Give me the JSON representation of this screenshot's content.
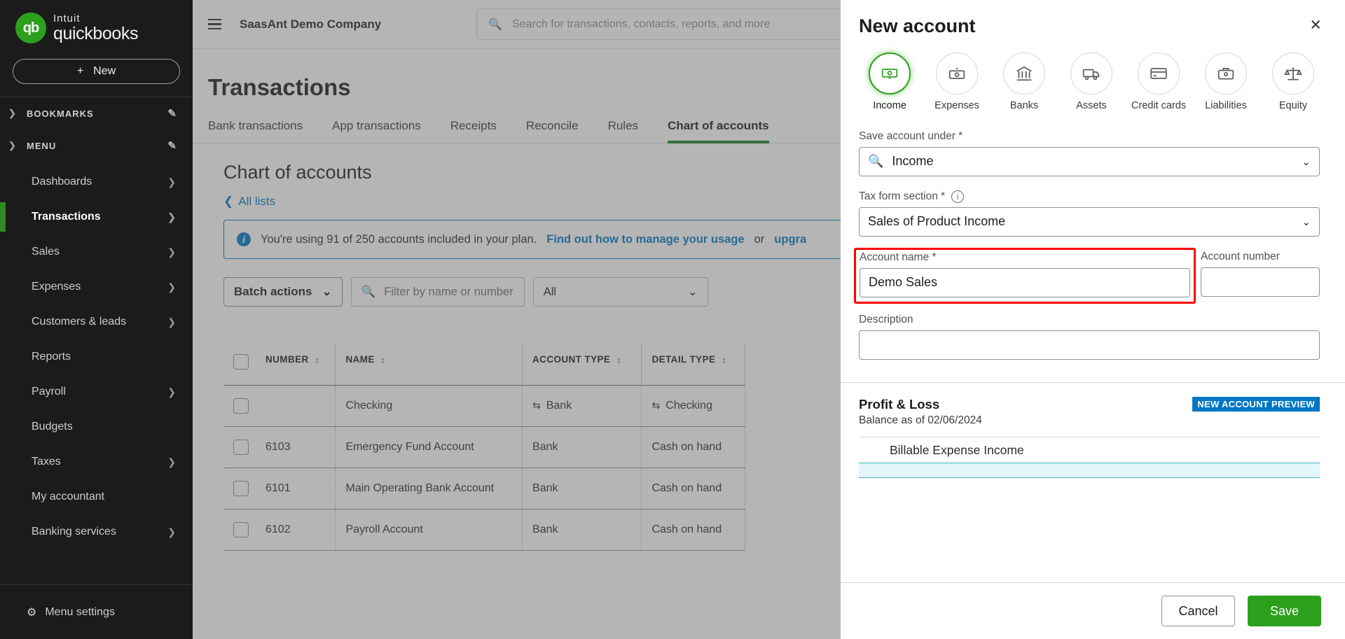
{
  "sidebar": {
    "brand": {
      "intuit": "Intuit",
      "product": "quickbooks"
    },
    "new_button": "New",
    "bookmarks_label": "BOOKMARKS",
    "menu_label": "MENU",
    "items": [
      {
        "label": "Dashboards",
        "has_arrow": true,
        "active": false
      },
      {
        "label": "Transactions",
        "has_arrow": true,
        "active": true
      },
      {
        "label": "Sales",
        "has_arrow": true,
        "active": false
      },
      {
        "label": "Expenses",
        "has_arrow": true,
        "active": false
      },
      {
        "label": "Customers & leads",
        "has_arrow": true,
        "active": false
      },
      {
        "label": "Reports",
        "has_arrow": false,
        "active": false
      },
      {
        "label": "Payroll",
        "has_arrow": true,
        "active": false
      },
      {
        "label": "Budgets",
        "has_arrow": false,
        "active": false
      },
      {
        "label": "Taxes",
        "has_arrow": true,
        "active": false
      },
      {
        "label": "My accountant",
        "has_arrow": false,
        "active": false
      },
      {
        "label": "Banking services",
        "has_arrow": true,
        "active": false
      }
    ],
    "menu_settings": "Menu settings"
  },
  "topbar": {
    "company": "SaasAnt Demo Company",
    "search_placeholder": "Search for transactions, contacts, reports, and more"
  },
  "page": {
    "title": "Transactions",
    "tabs": [
      {
        "label": "Bank transactions",
        "active": false
      },
      {
        "label": "App transactions",
        "active": false
      },
      {
        "label": "Receipts",
        "active": false
      },
      {
        "label": "Reconcile",
        "active": false
      },
      {
        "label": "Rules",
        "active": false
      },
      {
        "label": "Chart of accounts",
        "active": true
      }
    ],
    "section_title": "Chart of accounts",
    "back_link": "All lists",
    "banner": {
      "text_before": "You're using 91 of 250 accounts included in your plan.",
      "link1": "Find out how to manage your usage",
      "text_middle": "or",
      "link2": "upgra"
    },
    "filters": {
      "batch_actions": "Batch actions",
      "filter_placeholder": "Filter by name or number",
      "select_value": "All"
    },
    "table": {
      "columns": [
        "NUMBER",
        "NAME",
        "ACCOUNT TYPE",
        "DETAIL TYPE"
      ],
      "rows": [
        {
          "number": "",
          "name": "Checking",
          "account_type": "Bank",
          "detail_type": "Checking",
          "icon": true
        },
        {
          "number": "6103",
          "name": "Emergency Fund Account",
          "account_type": "Bank",
          "detail_type": "Cash on hand",
          "icon": false
        },
        {
          "number": "6101",
          "name": "Main Operating Bank Account",
          "account_type": "Bank",
          "detail_type": "Cash on hand",
          "icon": false
        },
        {
          "number": "6102",
          "name": "Payroll Account",
          "account_type": "Bank",
          "detail_type": "Cash on hand",
          "icon": false
        }
      ]
    }
  },
  "panel": {
    "title": "New account",
    "close_label": "×",
    "account_types": [
      {
        "label": "Income",
        "icon": "income-bill-icon",
        "selected": true
      },
      {
        "label": "Expenses",
        "icon": "expenses-bill-icon",
        "selected": false
      },
      {
        "label": "Banks",
        "icon": "bank-building-icon",
        "selected": false
      },
      {
        "label": "Assets",
        "icon": "truck-icon",
        "selected": false
      },
      {
        "label": "Credit cards",
        "icon": "credit-card-icon",
        "selected": false
      },
      {
        "label": "Liabilities",
        "icon": "briefcase-icon",
        "selected": false
      },
      {
        "label": "Equity",
        "icon": "scale-icon",
        "selected": false
      }
    ],
    "fields": {
      "save_under_label": "Save account under *",
      "save_under_value": "Income",
      "tax_form_label": "Tax form section *",
      "tax_form_value": "Sales of Product Income",
      "account_name_label": "Account name *",
      "account_name_value": "Demo Sales",
      "account_number_label": "Account number",
      "account_number_value": "",
      "description_label": "Description",
      "description_value": ""
    },
    "preview": {
      "title": "Profit & Loss",
      "subtitle": "Balance as of 02/06/2024",
      "badge": "NEW ACCOUNT PREVIEW",
      "items": [
        "Billable Expense Income"
      ]
    },
    "buttons": {
      "cancel": "Cancel",
      "save": "Save"
    }
  },
  "colors": {
    "brand_green": "#2ca01c",
    "link_blue": "#0077c5",
    "highlight_red": "#ff0000",
    "sidebar_bg": "#1b1b1b"
  }
}
